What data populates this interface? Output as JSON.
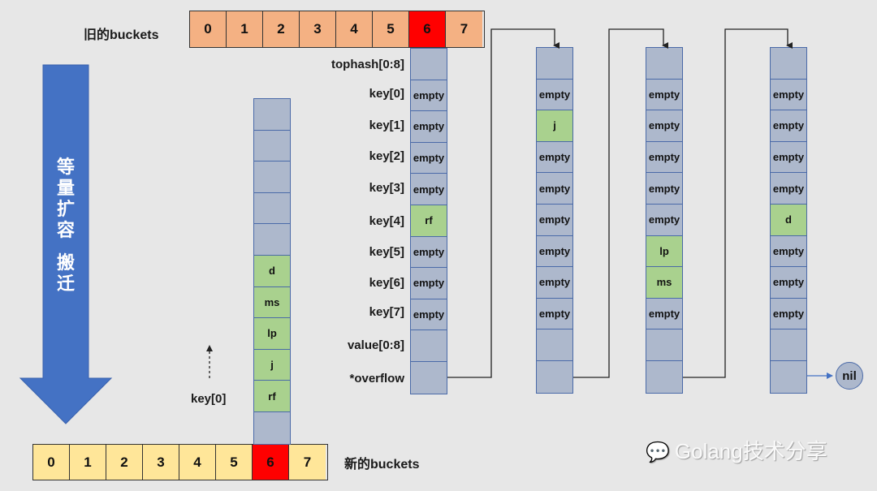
{
  "old_buckets": {
    "label": "旧的buckets",
    "cells": [
      "0",
      "1",
      "2",
      "3",
      "4",
      "5",
      "6",
      "7"
    ],
    "highlight_index": 6
  },
  "new_buckets": {
    "label": "新的buckets",
    "cells": [
      "0",
      "1",
      "2",
      "3",
      "4",
      "5",
      "6",
      "7"
    ],
    "highlight_index": 6
  },
  "row_labels": [
    "tophash[0:8]",
    "key[0]",
    "key[1]",
    "key[2]",
    "key[3]",
    "key[4]",
    "key[5]",
    "key[6]",
    "key[7]",
    "value[0:8]",
    "*overflow"
  ],
  "migration_arrow": {
    "chars": [
      "等",
      "量",
      "扩",
      "容",
      "",
      "搬",
      "迁"
    ]
  },
  "old_bucket_chain": [
    {
      "name": "bucket-6",
      "cells": [
        "",
        "empty",
        "empty",
        "empty",
        "empty",
        "rf",
        "empty",
        "empty",
        "empty",
        "",
        ""
      ]
    },
    {
      "name": "overflow-1",
      "cells": [
        "",
        "empty",
        "j",
        "empty",
        "empty",
        "empty",
        "empty",
        "empty",
        "empty",
        "",
        ""
      ]
    },
    {
      "name": "overflow-2",
      "cells": [
        "",
        "empty",
        "empty",
        "empty",
        "empty",
        "empty",
        "lp",
        "ms",
        "empty",
        "",
        ""
      ]
    },
    {
      "name": "overflow-3",
      "cells": [
        "",
        "empty",
        "empty",
        "empty",
        "empty",
        "d",
        "empty",
        "empty",
        "empty",
        "",
        ""
      ]
    }
  ],
  "filled_values": [
    "rf",
    "j",
    "lp",
    "ms",
    "d"
  ],
  "new_bucket_column": {
    "cells": [
      "",
      "",
      "",
      "",
      "",
      "d",
      "ms",
      "lp",
      "j",
      "rf",
      ""
    ],
    "key_pointer_label": "key[0]"
  },
  "nil_label": "nil",
  "colors": {
    "old_bucket_fill": "#f4b183",
    "new_bucket_fill": "#ffe699",
    "highlight_fill": "#ff0000",
    "slot_fill": "#adb8cc",
    "filled_slot": "#a9d18e",
    "arrow_fill": "#4472c4"
  },
  "watermark": "Golang技术分享"
}
